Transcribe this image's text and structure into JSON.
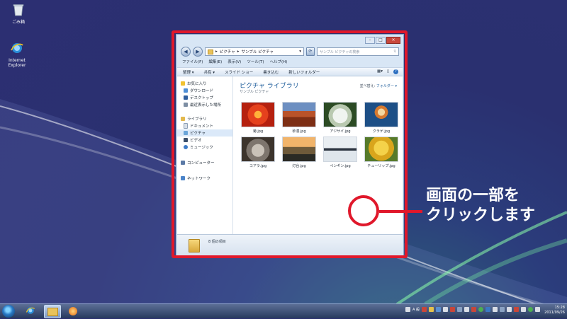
{
  "desktop": {
    "icons": [
      {
        "label": "ごみ箱",
        "icon": "recycle-bin-icon"
      },
      {
        "label": "Internet Explorer",
        "icon": "internet-explorer-icon"
      }
    ]
  },
  "window": {
    "address": {
      "segments": [
        "ピクチャ",
        "サンプル ピクチャ"
      ],
      "separator": "▸"
    },
    "search_placeholder": "サンプル ピクチャの検索",
    "menu": [
      "ファイル(F)",
      "編集(E)",
      "表示(V)",
      "ツール(T)",
      "ヘルプ(H)"
    ],
    "toolbar": [
      "整理 ▾",
      "共有 ▾",
      "スライド ショー",
      "書き込む",
      "新しいフォルダー"
    ],
    "nav": {
      "favorites": {
        "label": "お気に入り",
        "items": [
          "ダウンロード",
          "デスクトップ",
          "最近表示した場所"
        ]
      },
      "libraries": {
        "label": "ライブラリ",
        "items": [
          "ドキュメント",
          "ピクチャ",
          "ビデオ",
          "ミュージック"
        ]
      },
      "computer": "コンピューター",
      "network": "ネットワーク"
    },
    "library": {
      "title": "ピクチャ ライブラリ",
      "subtitle": "サンプル ピクチャ",
      "arrange_label": "並べ替え:",
      "arrange_value": "フォルダー ▾"
    },
    "files": [
      {
        "name": "菊.jpg",
        "thumb": "chrysanthemum"
      },
      {
        "name": "砂漠.jpg",
        "thumb": "desert"
      },
      {
        "name": "アジサイ.jpg",
        "thumb": "hydrangeas"
      },
      {
        "name": "クラゲ.jpg",
        "thumb": "jellyfish"
      },
      {
        "name": "コアラ.jpg",
        "thumb": "koala"
      },
      {
        "name": "灯台.jpg",
        "thumb": "lighthouse"
      },
      {
        "name": "ペンギン.jpg",
        "thumb": "penguins"
      },
      {
        "name": "チューリップ.jpg",
        "thumb": "tulips"
      }
    ],
    "details": "8 個の項目"
  },
  "annotation": {
    "line1": "画面の一部を",
    "line2": "クリックします",
    "color": "#e0182b"
  },
  "taskbar": {
    "lang": "A 般",
    "time": "15:28",
    "date": "2011/09/26"
  }
}
